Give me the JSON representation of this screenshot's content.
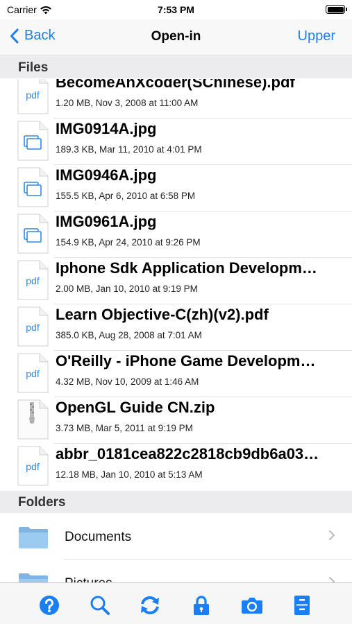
{
  "status_bar": {
    "carrier": "Carrier",
    "time": "7:53 PM"
  },
  "nav": {
    "back_label": "Back",
    "title": "Open-in",
    "right_label": "Upper"
  },
  "sections": {
    "files": "Files",
    "folders": "Folders"
  },
  "files": [
    {
      "name": "BecomeAnXcoder(SChinese).pdf",
      "meta": "1.20 MB, Nov 3, 2008 at 11:00 AM",
      "type": "pdf",
      "icon_text": "pdf"
    },
    {
      "name": "IMG0914A.jpg",
      "meta": "189.3 KB, Mar 11, 2010 at 4:01 PM",
      "type": "image",
      "icon_text": ""
    },
    {
      "name": "IMG0946A.jpg",
      "meta": "155.5 KB, Apr 6, 2010 at 6:58 PM",
      "type": "image",
      "icon_text": ""
    },
    {
      "name": "IMG0961A.jpg",
      "meta": "154.9 KB, Apr 24, 2010 at 9:26 PM",
      "type": "image",
      "icon_text": ""
    },
    {
      "name": "Iphone Sdk Application Developm…",
      "meta": "2.00 MB, Jan 10, 2010 at 9:19 PM",
      "type": "pdf",
      "icon_text": "pdf"
    },
    {
      "name": "Learn Objective-C(zh)(v2).pdf",
      "meta": "385.0 KB, Aug 28, 2008 at 7:01 AM",
      "type": "pdf",
      "icon_text": "pdf"
    },
    {
      "name": "O'Reilly - iPhone Game Developm…",
      "meta": "4.32 MB, Nov 10, 2009 at 1:46 AM",
      "type": "pdf",
      "icon_text": "pdf"
    },
    {
      "name": "OpenGL Guide CN.zip",
      "meta": "3.73 MB, Mar 5, 2011 at 9:19 PM",
      "type": "zip",
      "icon_text": ""
    },
    {
      "name": "abbr_0181cea822c2818cb9db6a03…",
      "meta": "12.18 MB, Jan 10, 2010 at 5:13 AM",
      "type": "pdf",
      "icon_text": "pdf"
    }
  ],
  "folders": [
    {
      "name": "Documents"
    },
    {
      "name": "Pictures"
    }
  ],
  "toolbar": [
    {
      "icon": "help-icon"
    },
    {
      "icon": "search-icon"
    },
    {
      "icon": "sync-icon"
    },
    {
      "icon": "lock-icon"
    },
    {
      "icon": "camera-icon"
    },
    {
      "icon": "cabinet-icon"
    }
  ],
  "colors": {
    "accent": "#1a7ff5",
    "header_bg": "#ececef",
    "folder": "#8fc3ef"
  }
}
